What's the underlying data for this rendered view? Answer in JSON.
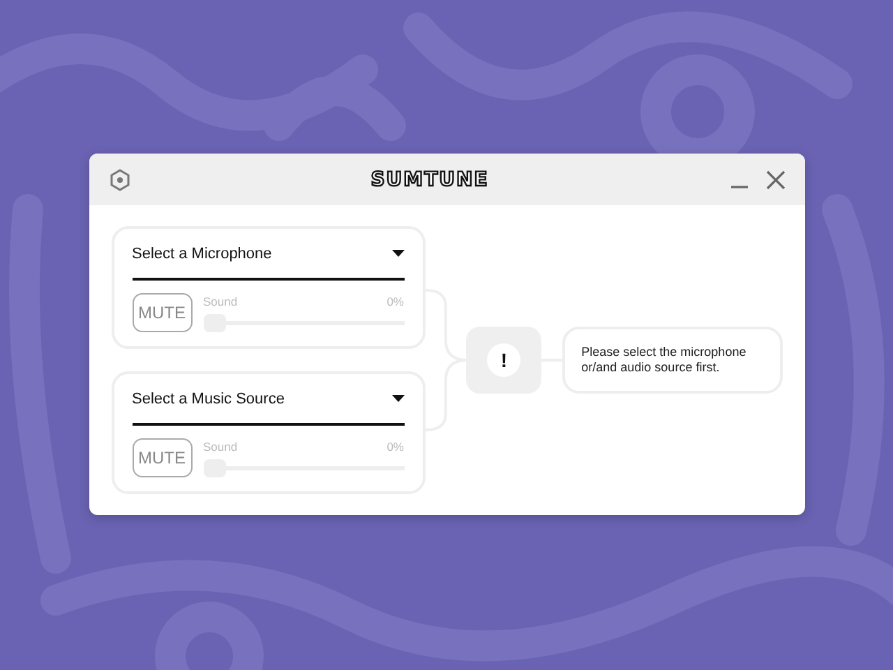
{
  "window": {
    "title": "SUMTUNE"
  },
  "sources": [
    {
      "placeholder": "Select a Microphone",
      "mute_label": "MUTE",
      "muted": false,
      "sound_label": "Sound",
      "reading": "0%",
      "level": 0
    },
    {
      "placeholder": "Select a Music Source",
      "mute_label": "MUTE",
      "muted": false,
      "sound_label": "Sound",
      "reading": "0%",
      "level": 0
    }
  ],
  "alert": {
    "icon": "!",
    "message": "Please select the microphone or/and audio source first."
  }
}
